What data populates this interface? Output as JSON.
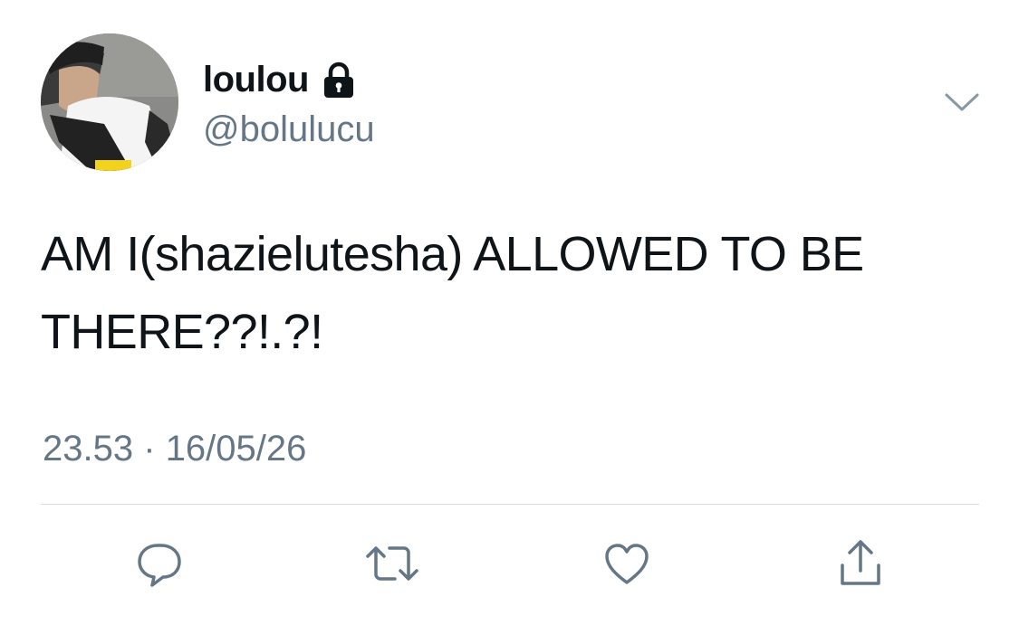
{
  "author": {
    "display_name": "loulou",
    "handle": "@bolulucu",
    "protected_icon": "lock-icon"
  },
  "tweet": {
    "text": "AM I(shazielutesha) ALLOWED TO BE THERE??!.?!",
    "time": "23.53",
    "separator": "·",
    "date": "16/05/26"
  },
  "actions": [
    "reply-icon",
    "retweet-icon",
    "like-icon",
    "share-icon"
  ],
  "colors": {
    "text_primary": "#0f1419",
    "text_secondary": "#657786",
    "divider": "#d6dde3",
    "icon": "#657786"
  }
}
